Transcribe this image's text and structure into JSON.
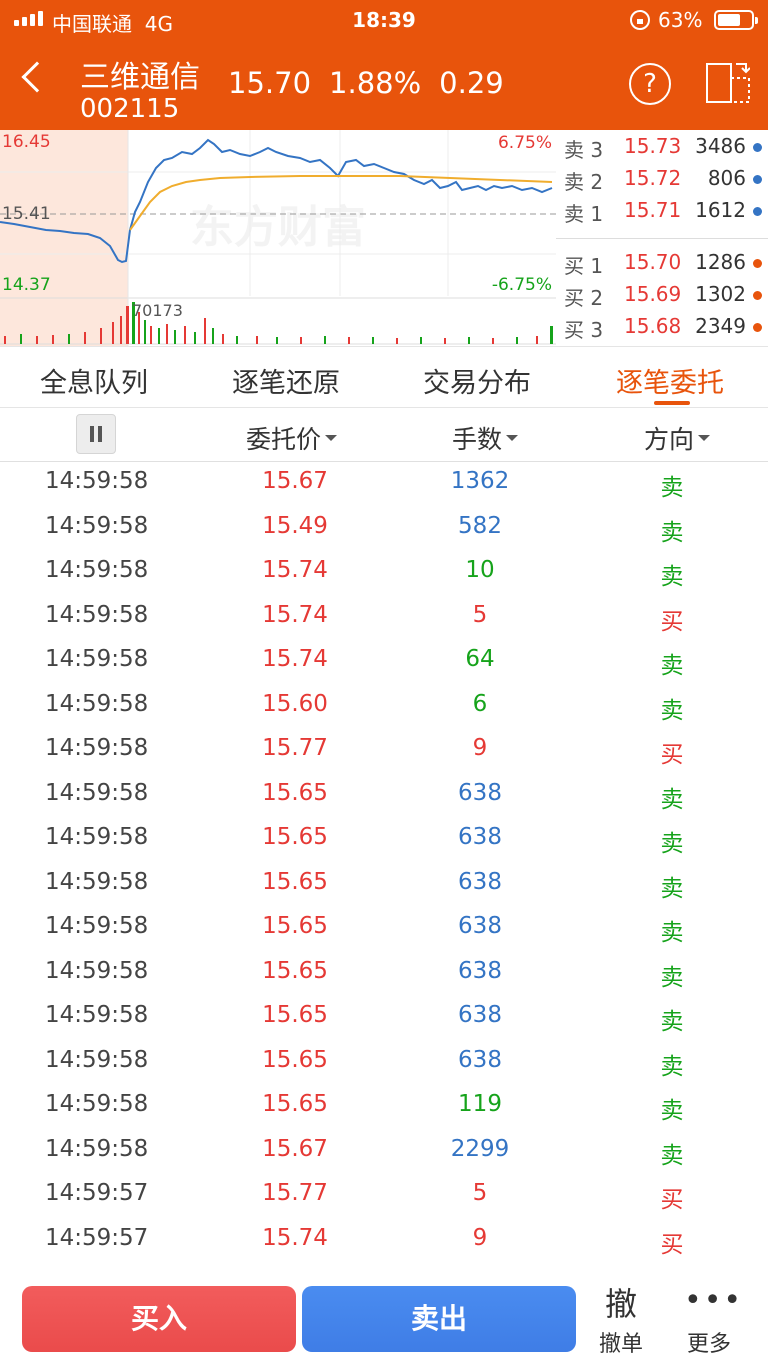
{
  "status": {
    "carrier": "中国联通",
    "network": "4G",
    "time": "18:39",
    "battery": "63%"
  },
  "header": {
    "name": "三维通信",
    "code": "002115",
    "price": "15.70",
    "change_pct": "1.88%",
    "change": "0.29"
  },
  "chart": {
    "high": "16.45",
    "prev_close": "15.41",
    "low": "14.37",
    "up_pct": "6.75%",
    "down_pct": "-6.75%",
    "volume_label": "70173",
    "watermark": "东方财富"
  },
  "order_book": [
    {
      "label": "卖 3",
      "price": "15.73",
      "volume": "3486",
      "color": "#3474c4"
    },
    {
      "label": "卖 2",
      "price": "15.72",
      "volume": "806",
      "color": "#3474c4"
    },
    {
      "label": "卖 1",
      "price": "15.71",
      "volume": "1612",
      "color": "#3474c4"
    },
    {
      "label": "买 1",
      "price": "15.70",
      "volume": "1286",
      "color": "#e8540c"
    },
    {
      "label": "买 2",
      "price": "15.69",
      "volume": "1302",
      "color": "#e8540c"
    },
    {
      "label": "买 3",
      "price": "15.68",
      "volume": "2349",
      "color": "#e8540c"
    }
  ],
  "tabs": [
    "全息队列",
    "逐笔还原",
    "交易分布",
    "逐笔委托"
  ],
  "columns": {
    "price": "委托价",
    "quantity": "手数",
    "direction": "方向"
  },
  "rows": [
    {
      "time": "14:59:58",
      "price": "15.67",
      "qty": "1362",
      "qty_color": "blue",
      "dir": "卖",
      "dir_color": "green"
    },
    {
      "time": "14:59:58",
      "price": "15.49",
      "qty": "582",
      "qty_color": "blue",
      "dir": "卖",
      "dir_color": "green"
    },
    {
      "time": "14:59:58",
      "price": "15.74",
      "qty": "10",
      "qty_color": "green",
      "dir": "卖",
      "dir_color": "green"
    },
    {
      "time": "14:59:58",
      "price": "15.74",
      "qty": "5",
      "qty_color": "red",
      "dir": "买",
      "dir_color": "red"
    },
    {
      "time": "14:59:58",
      "price": "15.74",
      "qty": "64",
      "qty_color": "green",
      "dir": "卖",
      "dir_color": "green"
    },
    {
      "time": "14:59:58",
      "price": "15.60",
      "qty": "6",
      "qty_color": "green",
      "dir": "卖",
      "dir_color": "green"
    },
    {
      "time": "14:59:58",
      "price": "15.77",
      "qty": "9",
      "qty_color": "red",
      "dir": "买",
      "dir_color": "red"
    },
    {
      "time": "14:59:58",
      "price": "15.65",
      "qty": "638",
      "qty_color": "blue",
      "dir": "卖",
      "dir_color": "green"
    },
    {
      "time": "14:59:58",
      "price": "15.65",
      "qty": "638",
      "qty_color": "blue",
      "dir": "卖",
      "dir_color": "green"
    },
    {
      "time": "14:59:58",
      "price": "15.65",
      "qty": "638",
      "qty_color": "blue",
      "dir": "卖",
      "dir_color": "green"
    },
    {
      "time": "14:59:58",
      "price": "15.65",
      "qty": "638",
      "qty_color": "blue",
      "dir": "卖",
      "dir_color": "green"
    },
    {
      "time": "14:59:58",
      "price": "15.65",
      "qty": "638",
      "qty_color": "blue",
      "dir": "卖",
      "dir_color": "green"
    },
    {
      "time": "14:59:58",
      "price": "15.65",
      "qty": "638",
      "qty_color": "blue",
      "dir": "卖",
      "dir_color": "green"
    },
    {
      "time": "14:59:58",
      "price": "15.65",
      "qty": "638",
      "qty_color": "blue",
      "dir": "卖",
      "dir_color": "green"
    },
    {
      "time": "14:59:58",
      "price": "15.65",
      "qty": "119",
      "qty_color": "green",
      "dir": "卖",
      "dir_color": "green"
    },
    {
      "time": "14:59:58",
      "price": "15.67",
      "qty": "2299",
      "qty_color": "blue",
      "dir": "卖",
      "dir_color": "green"
    },
    {
      "time": "14:59:57",
      "price": "15.77",
      "qty": "5",
      "qty_color": "red",
      "dir": "买",
      "dir_color": "red"
    },
    {
      "time": "14:59:57",
      "price": "15.74",
      "qty": "9",
      "qty_color": "red",
      "dir": "买",
      "dir_color": "red"
    }
  ],
  "bottom": {
    "buy": "买入",
    "sell": "卖出",
    "undo_big": "撤",
    "undo": "撤单",
    "more": "更多"
  },
  "icons": [
    "signal-icon",
    "lock-rotation-icon",
    "battery-icon",
    "back-icon",
    "help-icon",
    "rotate-screen-icon",
    "pause-icon",
    "more-icon"
  ]
}
